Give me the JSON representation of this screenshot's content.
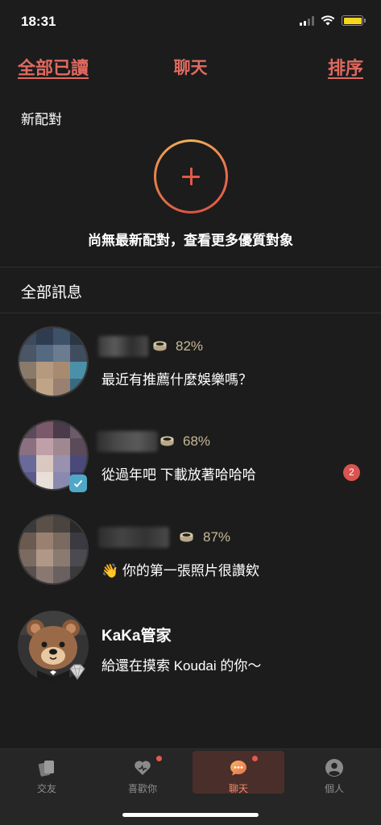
{
  "status_bar": {
    "time": "18:31"
  },
  "nav": {
    "left_action": "全部已讀",
    "title": "聊天",
    "right_action": "排序"
  },
  "new_matches": {
    "label": "新配對",
    "empty_text": "尚無最新配對，查看更多優質對象"
  },
  "all_messages": {
    "label": "全部訊息"
  },
  "conversations": [
    {
      "match": "82%",
      "message": "最近有推薦什麼娛樂嗎？"
    },
    {
      "match": "68%",
      "message": "從過年吧 下載放著哈哈哈",
      "unread": "2"
    },
    {
      "match": "87%",
      "message": "👋 你的第一張照片很讚欸"
    },
    {
      "name": "KaKa管家",
      "message": "給還在摸索 Koudai 的你～"
    }
  ],
  "tabs": [
    {
      "label": "交友",
      "icon": "cards-icon"
    },
    {
      "label": "喜歡你",
      "icon": "heart-icon"
    },
    {
      "label": "聊天",
      "icon": "chat-bubble-icon"
    },
    {
      "label": "個人",
      "icon": "person-icon"
    }
  ],
  "colors": {
    "accent": "#e06a60",
    "background": "#1c1c1c",
    "match_gold": "#c8b898",
    "badge_red": "#d9534f"
  }
}
